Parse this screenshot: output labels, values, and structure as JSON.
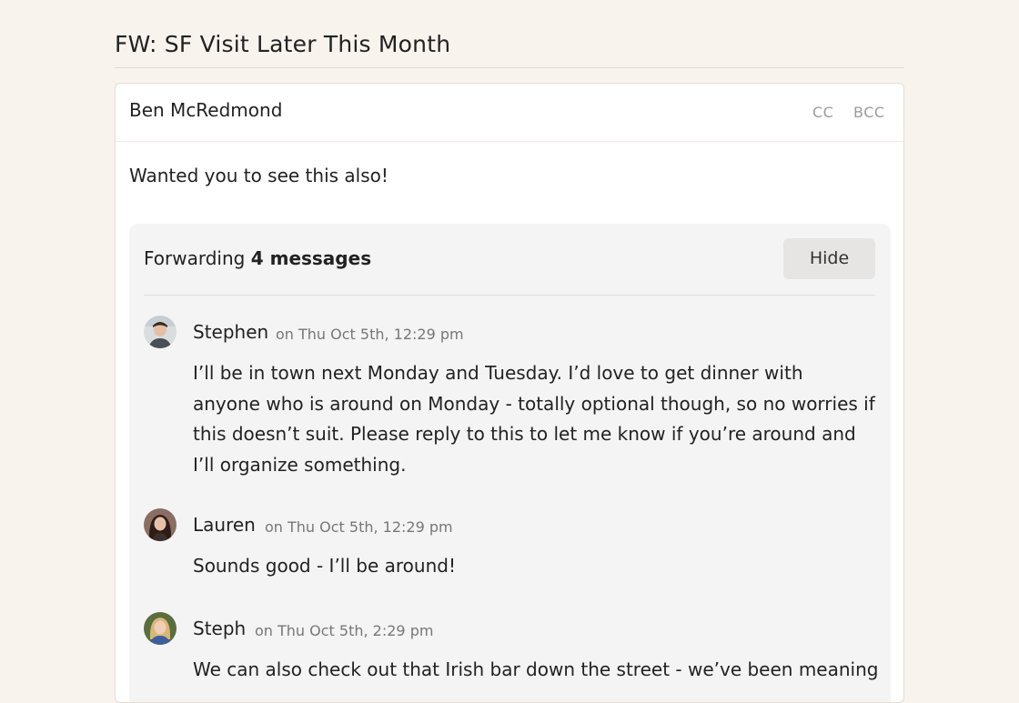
{
  "subject": "FW: SF Visit Later This Month",
  "compose": {
    "recipient": "Ben McRedmond",
    "cc_label": "CC",
    "bcc_label": "BCC",
    "body": "Wanted you to see this also!"
  },
  "forward": {
    "prefix": "Forwarding",
    "count_label": "4 messages",
    "hide_label": "Hide",
    "messages": [
      {
        "sender": "Stephen",
        "meta": "on Thu Oct 5th, 12:29 pm",
        "text": "I’ll be in town next Monday and Tuesday. I’d love to get dinner with anyone who is around on Monday - totally optional though, so no worries if this doesn’t suit. Please reply to this to let me know if you’re around and I’ll organize something."
      },
      {
        "sender": "Lauren",
        "meta": "on Thu Oct 5th, 12:29 pm",
        "text": "Sounds good - I’ll be around!"
      },
      {
        "sender": "Steph",
        "meta": "on Thu Oct 5th, 2:29 pm",
        "text": "We can also check out that Irish bar down the street - we’ve been meaning"
      }
    ]
  }
}
